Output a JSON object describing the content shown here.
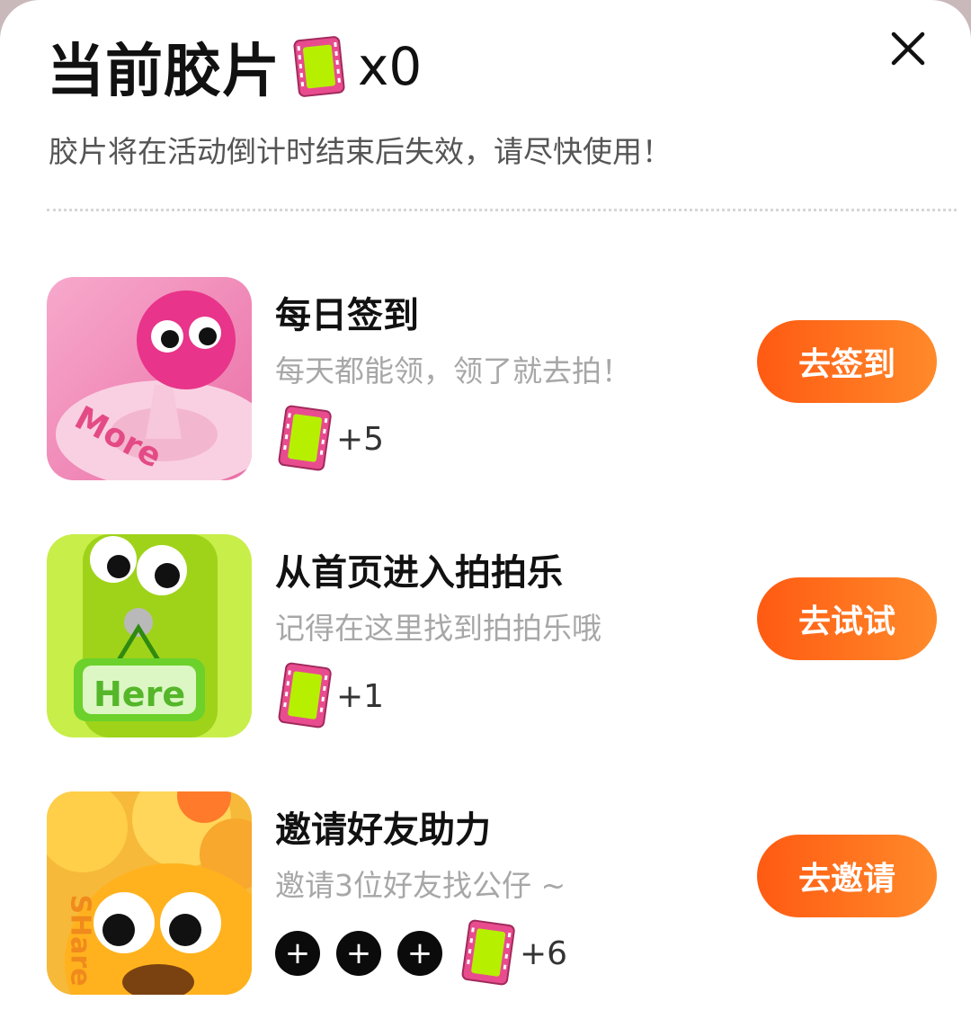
{
  "header": {
    "title": "当前胶片",
    "count": "x0",
    "subtitle": "胶片将在活动倒计时结束后失效，请尽快使用！"
  },
  "tasks": [
    {
      "title": "每日签到",
      "desc": "每天都能领，领了就去拍！",
      "reward": "+5",
      "cta": "去签到",
      "thumb_text": "More"
    },
    {
      "title": "从首页进入拍拍乐",
      "desc": "记得在这里找到拍拍乐哦",
      "reward": "+1",
      "cta": "去试试",
      "thumb_text": "Here"
    },
    {
      "title": "邀请好友助力",
      "desc": "邀请3位好友找公仔 ~",
      "reward": "+6",
      "cta": "去邀请",
      "thumb_text": "SHare",
      "invite_slots": [
        "+",
        "+",
        "+"
      ]
    }
  ],
  "colors": {
    "cta_start": "#ff5a12",
    "cta_end": "#ff8a2a",
    "film_frame": "#f0559a",
    "film_fill": "#b6f000"
  }
}
